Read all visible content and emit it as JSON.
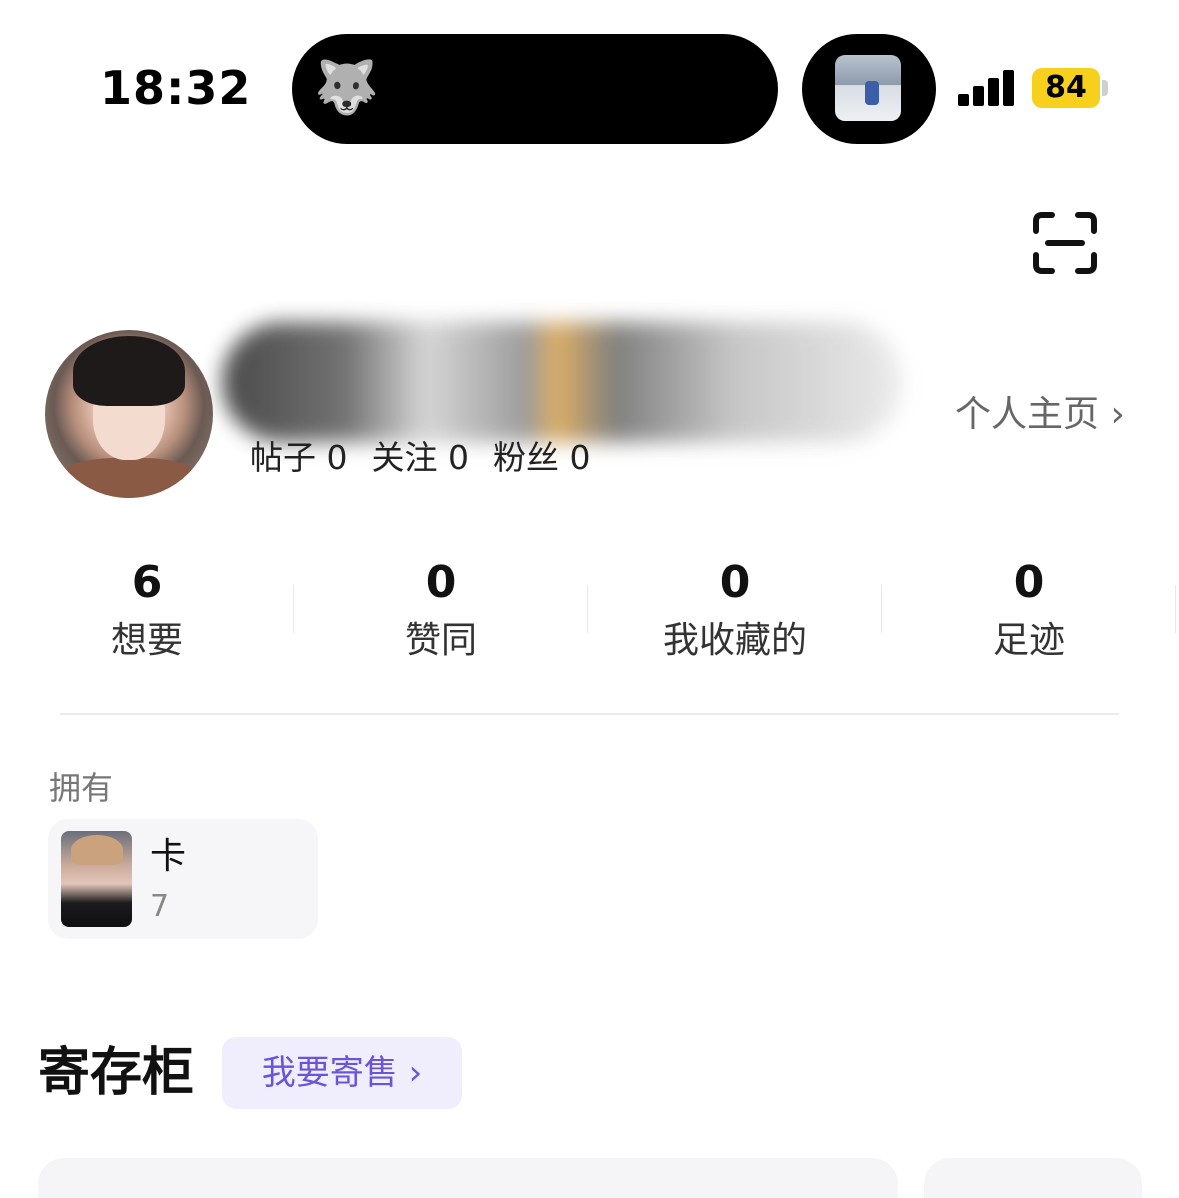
{
  "status_bar": {
    "time": "18:32",
    "island_icon": "🐺",
    "battery": "84",
    "battery_color": "#f7cf1d"
  },
  "header": {
    "scan_icon": "scan-icon"
  },
  "profile": {
    "stats": {
      "posts": "帖子 0",
      "following": "关注 0",
      "followers": "粉丝 0"
    },
    "homepage_link": "个人主页 ›"
  },
  "counters": [
    {
      "value": "6",
      "label": "想要"
    },
    {
      "value": "0",
      "label": "赞同"
    },
    {
      "value": "0",
      "label": "我收藏的"
    },
    {
      "value": "0",
      "label": "足迹"
    }
  ],
  "owned": {
    "title": "拥有",
    "items": [
      {
        "name": "卡",
        "count": "7"
      }
    ]
  },
  "storage": {
    "title": "寄存柜",
    "sell_button": "我要寄售 ›",
    "accent": "#6b55d6"
  }
}
